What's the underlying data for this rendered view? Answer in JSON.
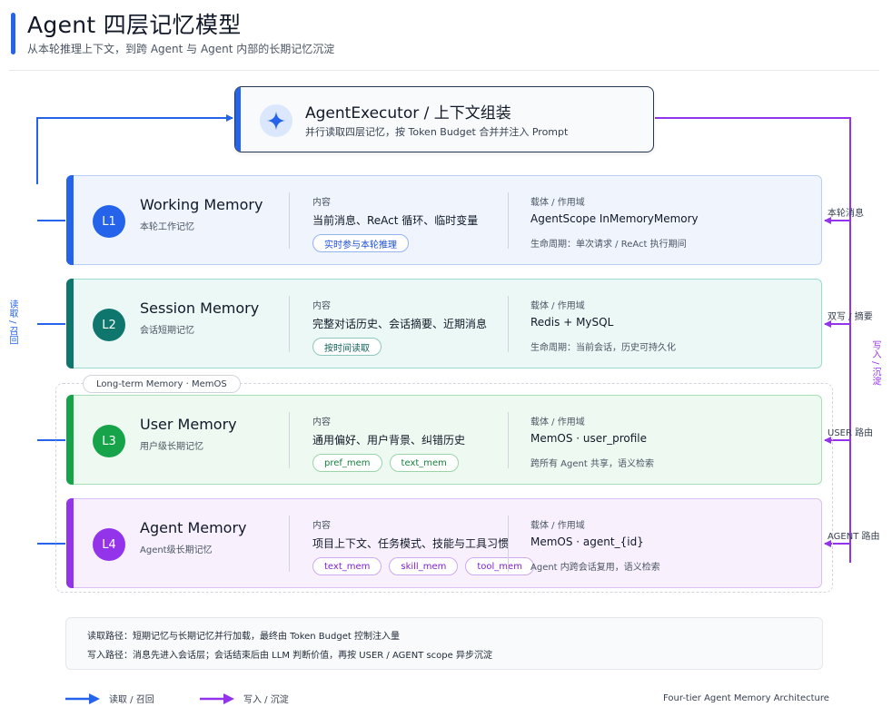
{
  "header": {
    "title": "Agent 四层记忆模型",
    "subtitle": "从本轮推理上下文，到跨 Agent 与 Agent 内部的长期记忆沉淀"
  },
  "executor": {
    "title": "AgentExecutor / 上下文组装",
    "subtitle": "并行读取四层记忆，按 Token Budget 合并并注入 Prompt",
    "icon": "sparkle-icon"
  },
  "layers": [
    {
      "badge": "L1",
      "name": "Working Memory",
      "sub": "本轮工作记忆",
      "content_label": "内容",
      "content": "当前消息、ReAct 循环、临时变量",
      "chips": [
        "实时参与本轮推理"
      ],
      "carrier_label": "载体 / 作用域",
      "carrier": "AgentScope InMemoryMemory",
      "note": "生命周期：单次请求 / ReAct 执行期间",
      "right_label": "本轮消息",
      "color": "#2563eb"
    },
    {
      "badge": "L2",
      "name": "Session Memory",
      "sub": "会话短期记忆",
      "content_label": "内容",
      "content": "完整对话历史、会话摘要、近期消息",
      "chips": [
        "按时间读取"
      ],
      "carrier_label": "载体 / 作用域",
      "carrier": "Redis + MySQL",
      "note": "生命周期：当前会话，历史可持久化",
      "right_label": "双写 / 摘要",
      "color": "#0f766e"
    },
    {
      "badge": "L3",
      "name": "User Memory",
      "sub": "用户级长期记忆",
      "content_label": "内容",
      "content": "通用偏好、用户背景、纠错历史",
      "chips": [
        "pref_mem",
        "text_mem"
      ],
      "carrier_label": "载体 / 作用域",
      "carrier": "MemOS · user_profile",
      "note": "跨所有 Agent 共享，语义检索",
      "right_label": "USER 路由",
      "color": "#16a34a"
    },
    {
      "badge": "L4",
      "name": "Agent Memory",
      "sub": "Agent级长期记忆",
      "content_label": "内容",
      "content": "项目上下文、任务模式、技能与工具习惯",
      "chips": [
        "text_mem",
        "skill_mem",
        "tool_mem"
      ],
      "carrier_label": "载体 / 作用域",
      "carrier": "MemOS · agent_{id}",
      "note": "Agent 内跨会话复用，语义检索",
      "right_label": "AGENT 路由",
      "color": "#9333ea"
    }
  ],
  "long_term_label": "Long-term Memory · MemOS",
  "side_labels": {
    "read": "读取 / 召回",
    "write": "写入 / 沉淀"
  },
  "footer": {
    "read_path": "读取路径：短期记忆与长期记忆并行加载，最终由 Token Budget 控制注入量",
    "write_path": "写入路径：消息先进入会话层；会话结束后由 LLM 判断价值，再按 USER / AGENT scope 异步沉淀"
  },
  "legend": {
    "read": "读取 / 召回",
    "read_color": "#2563eb",
    "write": "写入 / 沉淀",
    "write_color": "#9333ea"
  },
  "caption": "Four-tier Agent Memory Architecture"
}
